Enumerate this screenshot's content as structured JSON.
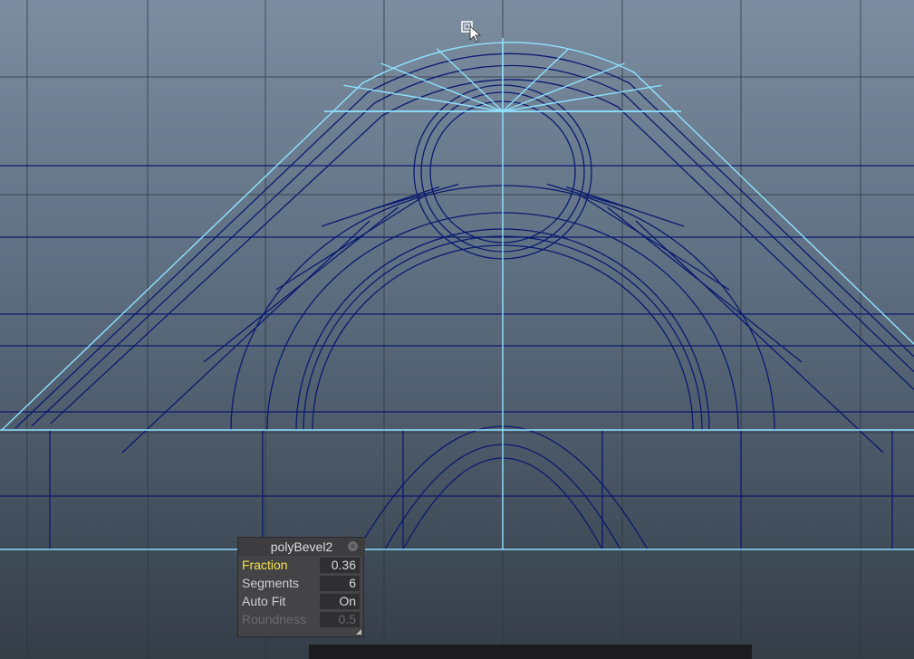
{
  "viewport": {
    "background_top": "#7c8da0",
    "background_bottom": "#353d47",
    "wire_color": "#0b1a6e",
    "edge_highlight": "#8fe2ff"
  },
  "hud": {
    "title": "polyBevel2",
    "menu_icon": "circle-menu-icon",
    "rows": [
      {
        "label": "Fraction",
        "value": "0.36",
        "state": "active"
      },
      {
        "label": "Segments",
        "value": "6",
        "state": "normal"
      },
      {
        "label": "Auto Fit",
        "value": "On",
        "state": "normal"
      },
      {
        "label": "Roundness",
        "value": "0.5",
        "state": "disabled"
      }
    ]
  },
  "cursor": {
    "icon": "move-tool-cursor-icon"
  }
}
